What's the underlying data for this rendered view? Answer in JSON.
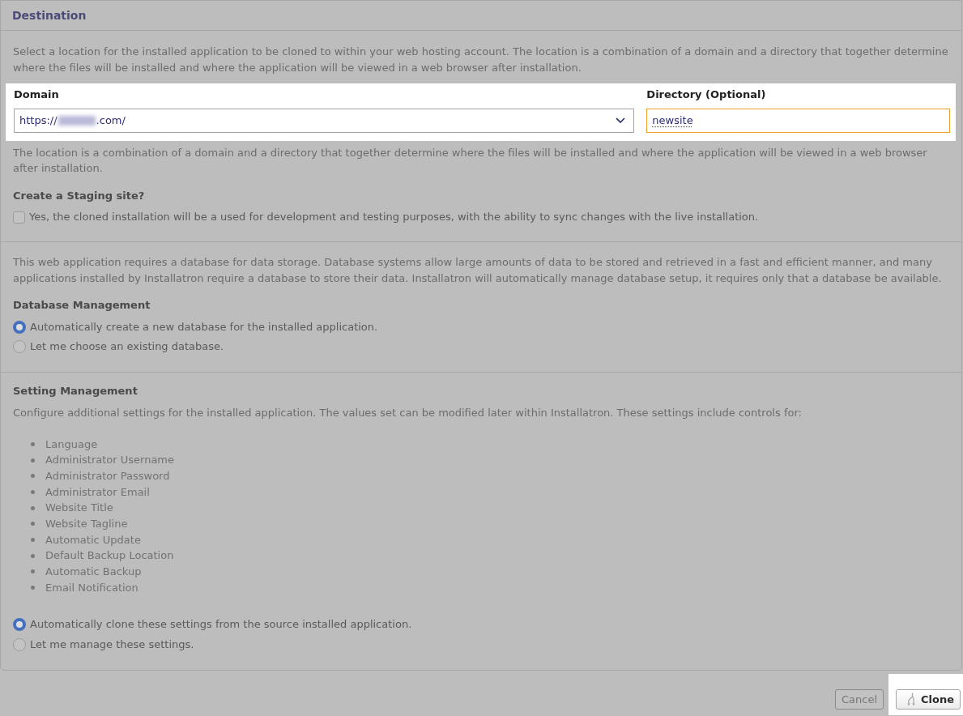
{
  "panel": {
    "title": "Destination"
  },
  "location": {
    "intro": "Select a location for the installed application to be cloned to within your web hosting account. The location is a combination of a domain and a directory that together determine where the files will be installed and where the application will be viewed in a web browser after installation.",
    "fields": {
      "highlighted": true,
      "domain": {
        "label": "Domain",
        "value_prefix": "https://",
        "redacted": true,
        "value_suffix": ".com/"
      },
      "directory": {
        "label": "Directory (Optional)",
        "value": "newsite",
        "focused": true,
        "spellcheck_flagged": true
      }
    },
    "note": "The location is a combination of a domain and a directory that together determine where the files will be installed and where the application will be viewed in a web browser after installation."
  },
  "staging": {
    "heading": "Create a Staging site?",
    "option": {
      "label": "Yes, the cloned installation will be a used for development and testing purposes, with the ability to sync changes with the live installation.",
      "checked": false
    }
  },
  "database": {
    "description": "This web application requires a database for data storage. Database systems allow large amounts of data to be stored and retrieved in a fast and efficient manner, and many applications installed by Installatron require a database to store their data. Installatron will automatically manage database setup, it requires only that a database be available.",
    "heading": "Database Management",
    "options": [
      {
        "label": "Automatically create a new database for the installed application.",
        "selected": true
      },
      {
        "label": "Let me choose an existing database.",
        "selected": false
      }
    ]
  },
  "settings": {
    "heading": "Setting Management",
    "description": "Configure additional settings for the installed application. The values set can be modified later within Installatron. These settings include controls for:",
    "items": [
      "Language",
      "Administrator Username",
      "Administrator Password",
      "Administrator Email",
      "Website Title",
      "Website Tagline",
      "Automatic Update",
      "Default Backup Location",
      "Automatic Backup",
      "Email Notification"
    ],
    "options": [
      {
        "label": "Automatically clone these settings from the source installed application.",
        "selected": true
      },
      {
        "label": "Let me manage these settings.",
        "selected": false
      }
    ]
  },
  "buttons": [
    {
      "label": "Cancel",
      "kind": "secondary",
      "highlighted": false
    },
    {
      "label": "Clone",
      "kind": "primary",
      "highlighted": true
    }
  ]
}
